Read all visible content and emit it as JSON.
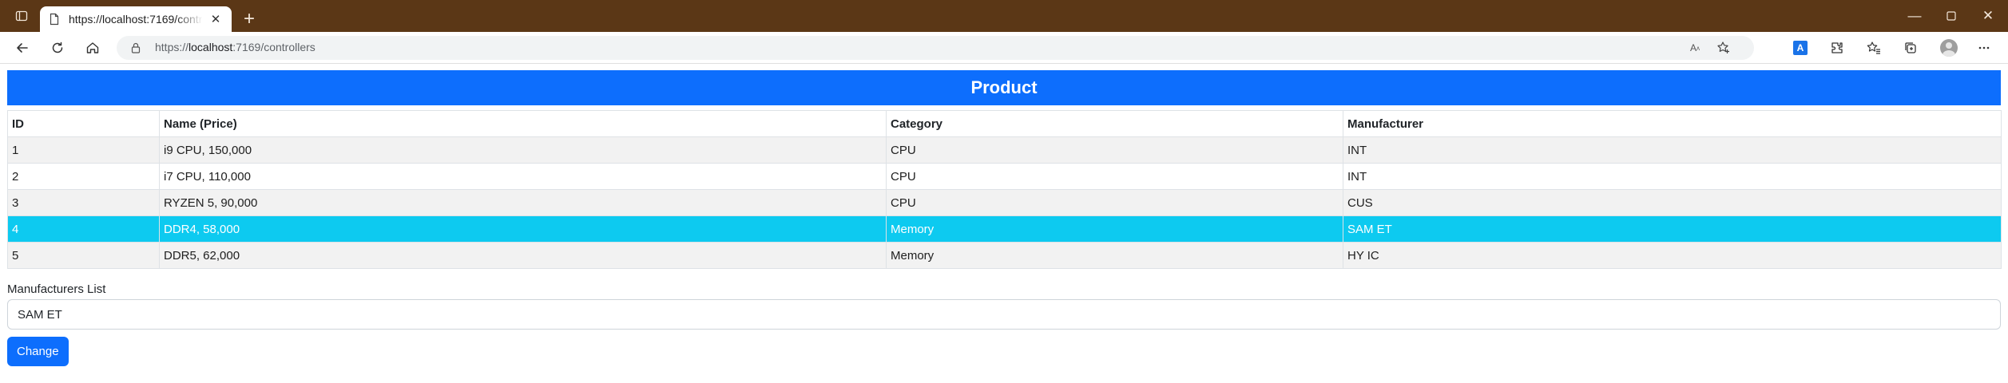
{
  "browser": {
    "tab_title": "https://localhost:7169/controllers",
    "address": {
      "scheme": "https://",
      "host": "localhost",
      "path": ":7169/controllers"
    },
    "theme_color": "#5b3716"
  },
  "page": {
    "banner_title": "Product",
    "banner_color": "#0d6efd",
    "table": {
      "headers": [
        "ID",
        "Name (Price)",
        "Category",
        "Manufacturer"
      ],
      "rows": [
        [
          "1",
          "i9 CPU, 150,000",
          "CPU",
          "INT"
        ],
        [
          "2",
          "i7 CPU, 110,000",
          "CPU",
          "INT"
        ],
        [
          "3",
          "RYZEN 5, 90,000",
          "CPU",
          "CUS"
        ],
        [
          "4",
          "DDR4, 58,000",
          "Memory",
          "SAM ET"
        ],
        [
          "5",
          "DDR5, 62,000",
          "Memory",
          "HY IC"
        ]
      ],
      "selected_row_index": 3,
      "selected_row_color": "#0dcaf0"
    },
    "manufacturers_label": "Manufacturers List",
    "manufacturers_selected": "SAM ET",
    "change_button_label": "Change"
  }
}
